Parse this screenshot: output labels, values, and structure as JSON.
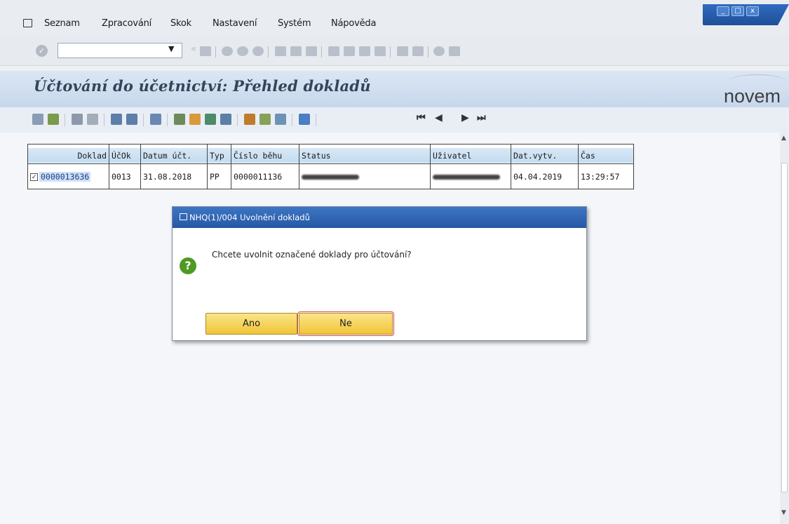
{
  "menubar": {
    "items": [
      "Seznam",
      "Zpracování",
      "Skok",
      "Nastavení",
      "Systém",
      "Nápověda"
    ]
  },
  "window_controls": {
    "minimize": "_",
    "maximize": "□",
    "close": "x"
  },
  "toolbar": {
    "command_field_value": ""
  },
  "header": {
    "title": "Účtování do účetnictví: Přehled dokladů",
    "logo": "novem"
  },
  "table": {
    "columns": [
      "Doklad",
      "ÚčOk",
      "Datum účt.",
      "Typ",
      "Číslo běhu",
      "Status",
      "Uživatel",
      "Dat.vytv.",
      "Čas"
    ],
    "rows": [
      {
        "selected": true,
        "doklad": "0000013636",
        "ucok": "0013",
        "datum_uct": "31.08.2018",
        "typ": "PP",
        "cislo_behu": "0000011136",
        "status": "",
        "uzivatel": "",
        "dat_vytv": "04.04.2019",
        "cas": "13:29:57"
      }
    ]
  },
  "dialog": {
    "title": "NHQ(1)/004 Uvolnění dokladů",
    "message": "Chcete uvolnit označené doklady pro účtování?",
    "icon": "question-icon",
    "buttons": {
      "yes": "Ano",
      "no": "Ne"
    }
  },
  "colors": {
    "dialog_title_bg": "#2657a4",
    "button_bg": "#f0c537",
    "question_icon": "#4f9a22",
    "header_bg": "#c7d8ec"
  }
}
